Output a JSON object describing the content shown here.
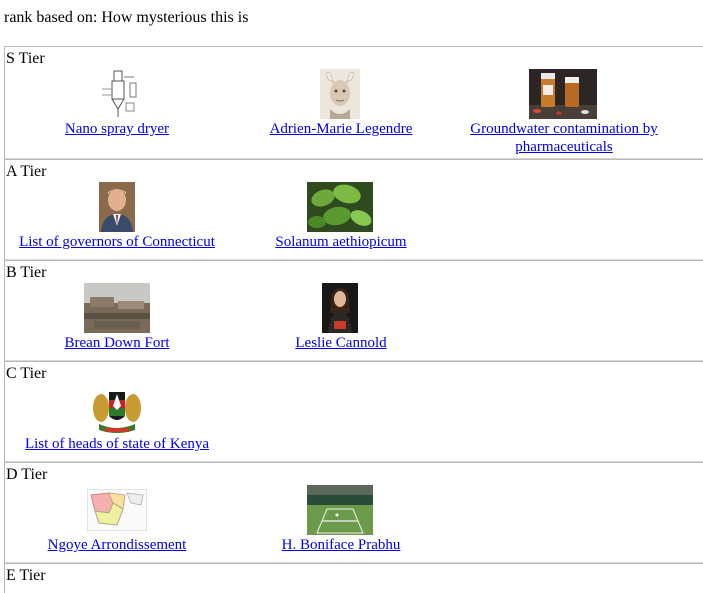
{
  "header": {
    "prefix": "rank based on:",
    "criterion": "How mysterious this is"
  },
  "tiers": [
    {
      "label": "S Tier",
      "items": [
        {
          "title": "Nano spray dryer",
          "image": "spray-dryer-diagram"
        },
        {
          "title": "Adrien-Marie Legendre",
          "image": "legendre-caricature"
        },
        {
          "title": "Groundwater contamination by pharmaceuticals",
          "image": "pill-bottles"
        }
      ]
    },
    {
      "label": "A Tier",
      "items": [
        {
          "title": "List of governors of Connecticut",
          "image": "governor-portrait"
        },
        {
          "title": "Solanum aethiopicum",
          "image": "green-leaves"
        }
      ]
    },
    {
      "label": "B Tier",
      "items": [
        {
          "title": "Brean Down Fort",
          "image": "fort-ruins"
        },
        {
          "title": "Leslie Cannold",
          "image": "speaker-portrait"
        }
      ]
    },
    {
      "label": "C Tier",
      "items": [
        {
          "title": "List of heads of state of Kenya",
          "image": "kenya-coat-of-arms"
        }
      ]
    },
    {
      "label": "D Tier",
      "items": [
        {
          "title": "Ngoye Arrondissement",
          "image": "arrondissement-map"
        },
        {
          "title": "H. Boniface Prabhu",
          "image": "tennis-court"
        }
      ]
    },
    {
      "label": "E Tier",
      "items": []
    }
  ]
}
